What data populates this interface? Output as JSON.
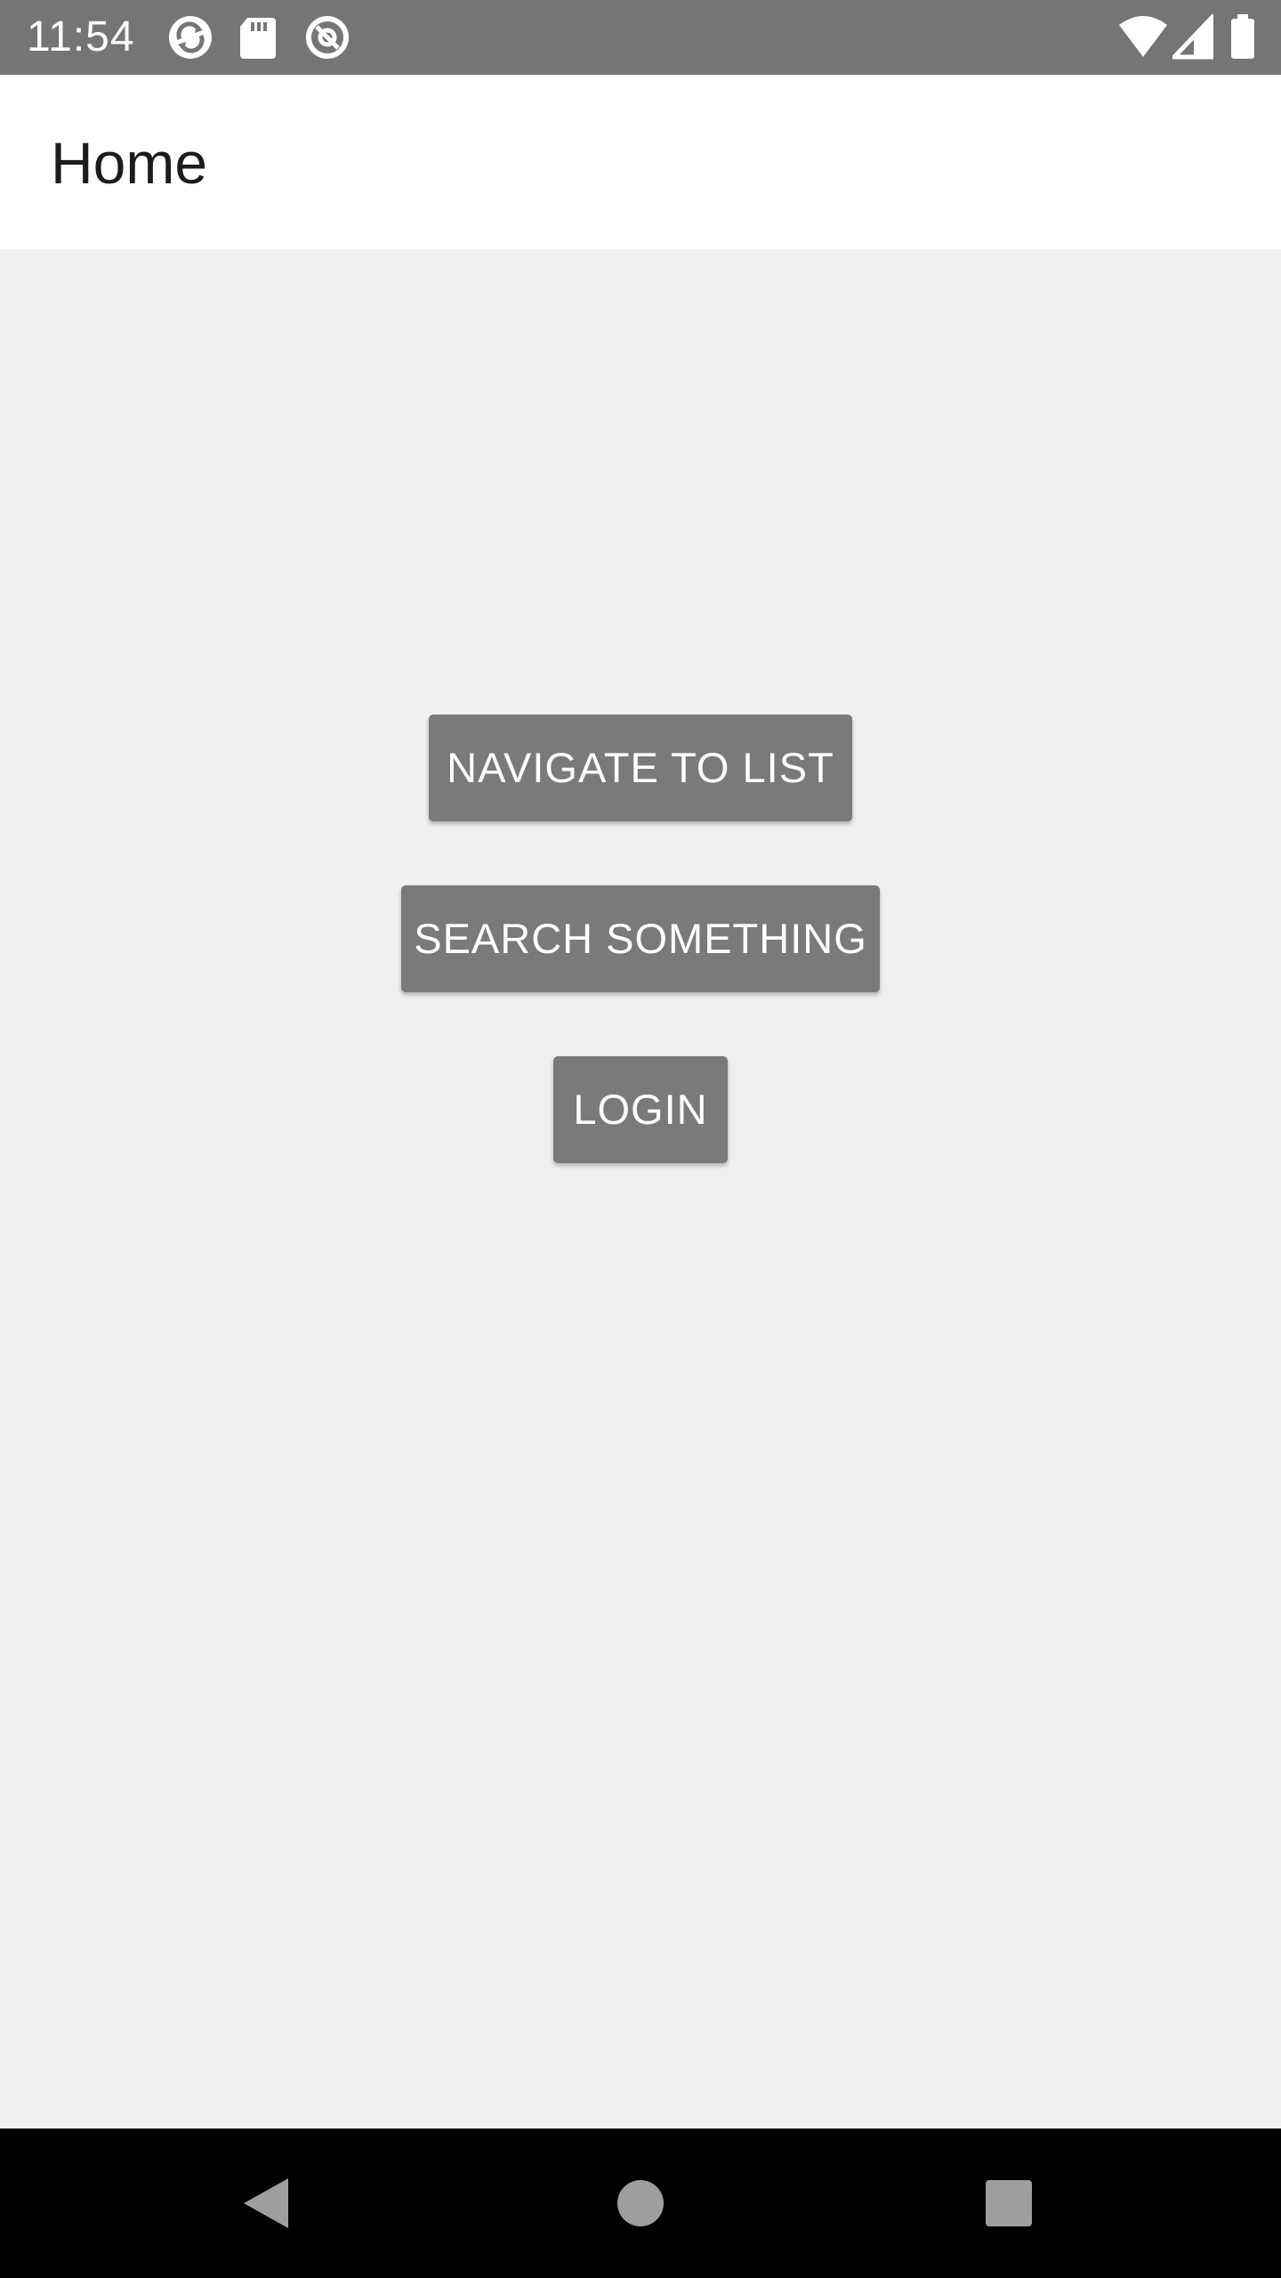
{
  "status_bar": {
    "time": "11:54",
    "icons": [
      "sync-icon",
      "sd-card-icon",
      "at-sign-icon",
      "wifi-icon",
      "cell-signal-icon",
      "battery-icon"
    ],
    "background_color": "#757575"
  },
  "app_bar": {
    "title": "Home",
    "background_color": "#ffffff"
  },
  "main": {
    "buttons": [
      {
        "label": "NAVIGATE TO LIST"
      },
      {
        "label": "SEARCH SOMETHING"
      },
      {
        "label": "LOGIN"
      }
    ],
    "button_color": "#7a7a7c",
    "background_color": "#f0f0f0"
  },
  "nav_bar": {
    "icons": [
      "back-icon",
      "home-icon",
      "recents-icon"
    ],
    "background_color": "#000000"
  }
}
